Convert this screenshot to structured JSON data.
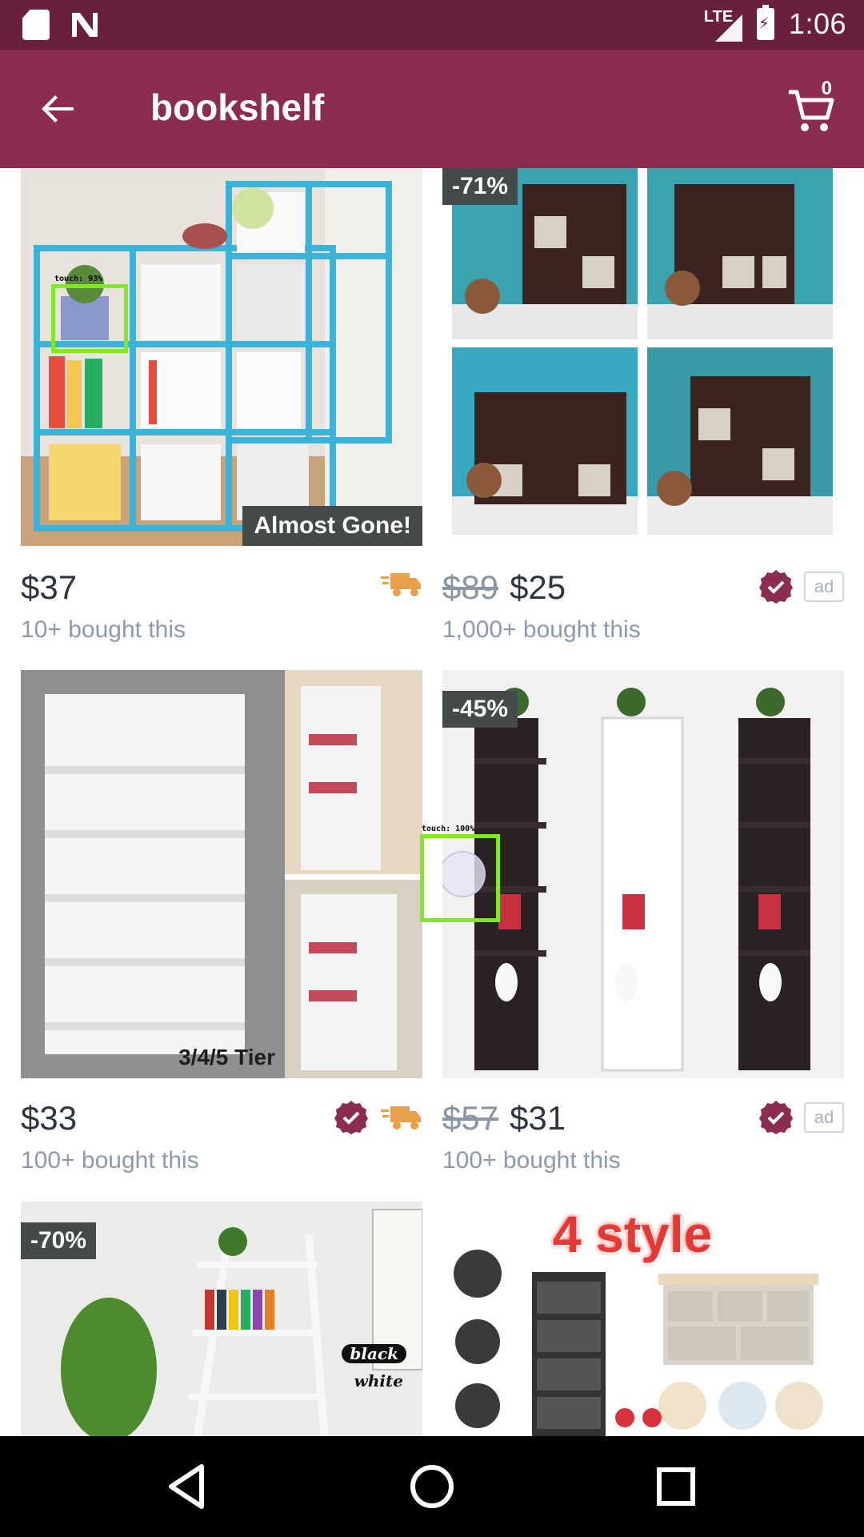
{
  "status_bar": {
    "network": "LTE",
    "time": "1:06"
  },
  "app_bar": {
    "title": "bookshelf",
    "cart_count": "0"
  },
  "colors": {
    "status_bar": "#6a1f3f",
    "app_bar": "#8b2c52",
    "accent": "#8b2c52",
    "truck": "#e8a04a"
  },
  "products": [
    {
      "discount": "",
      "tag": "Almost Gone!",
      "old_price": "",
      "price": "$37",
      "sold": "10+ bought this",
      "verified": false,
      "fast_shipping": true,
      "ad": ""
    },
    {
      "discount": "-71%",
      "tag": "",
      "old_price": "$89",
      "price": "$25",
      "sold": "1,000+ bought this",
      "verified": true,
      "fast_shipping": false,
      "ad": "ad"
    },
    {
      "discount": "",
      "tag": "3/4/5 Tier",
      "old_price": "",
      "price": "$33",
      "sold": "100+ bought this",
      "verified": true,
      "fast_shipping": true,
      "ad": ""
    },
    {
      "discount": "-45%",
      "tag": "",
      "old_price": "$57",
      "price": "$31",
      "sold": "100+ bought this",
      "verified": true,
      "fast_shipping": false,
      "ad": "ad"
    },
    {
      "discount": "-70%",
      "tag": "",
      "image_text": [
        "black",
        "white"
      ]
    },
    {
      "discount": "",
      "tag": "",
      "image_text": [
        "4 style"
      ]
    }
  ],
  "touch_overlays": [
    {
      "label": "touch: 93%"
    },
    {
      "label": "touch: 100%"
    }
  ]
}
